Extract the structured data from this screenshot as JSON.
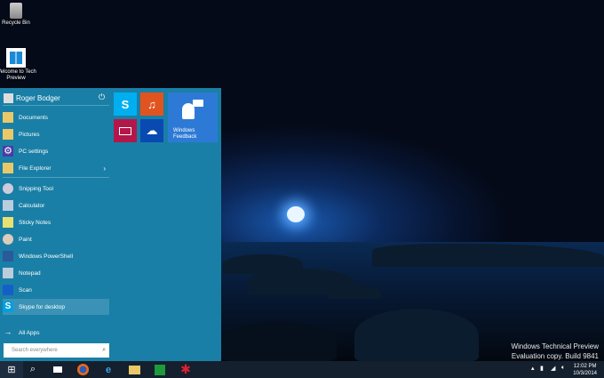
{
  "desktop": {
    "icons": [
      {
        "label": "Recycle Bin",
        "icon": "recycle-bin-icon"
      },
      {
        "label": "Welcome to Tech Preview",
        "icon": "windows-logo-icon"
      }
    ],
    "watermark": {
      "line1": "Windows Technical Preview",
      "line2": "Evaluation copy. Build 9841"
    }
  },
  "start_menu": {
    "user": "Roger Bodger",
    "places": [
      {
        "label": "Documents",
        "icon": "folder-icon"
      },
      {
        "label": "Pictures",
        "icon": "folder-icon"
      },
      {
        "label": "PC settings",
        "icon": "gear-icon"
      },
      {
        "label": "File Explorer",
        "icon": "folder-icon",
        "chevron": "›"
      }
    ],
    "apps": [
      {
        "label": "Snipping Tool"
      },
      {
        "label": "Calculator"
      },
      {
        "label": "Sticky Notes"
      },
      {
        "label": "Paint"
      },
      {
        "label": "Windows PowerShell"
      },
      {
        "label": "Notepad"
      },
      {
        "label": "Scan"
      },
      {
        "label": "Skype for desktop"
      }
    ],
    "all_apps": "All Apps",
    "search_placeholder": "Search everywhere",
    "tiles": {
      "feedback": "Windows Feedback"
    },
    "colors": {
      "skype": "#00aff0",
      "music": "#e1541f",
      "video": "#b3174a",
      "onedrive": "#094ab2",
      "feedback": "#2d7ad6"
    }
  },
  "taskbar": {
    "time": "12:02 PM",
    "date": "10/3/2014"
  }
}
